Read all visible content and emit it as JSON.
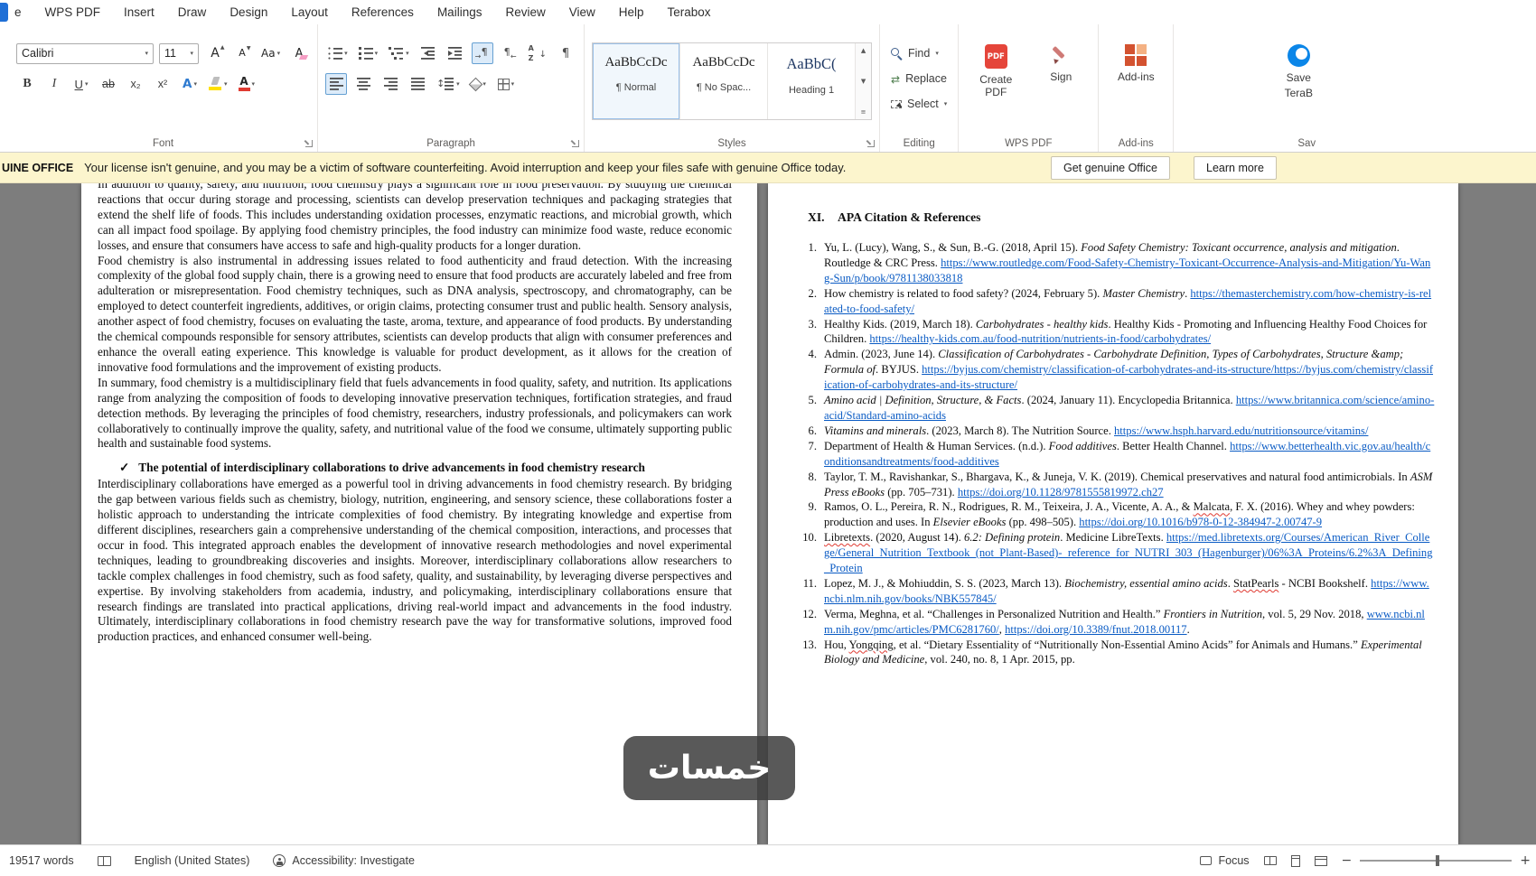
{
  "menu": {
    "tabs": [
      "e",
      "WPS PDF",
      "Insert",
      "Draw",
      "Design",
      "Layout",
      "References",
      "Mailings",
      "Review",
      "View",
      "Help",
      "Terabox"
    ]
  },
  "ribbon": {
    "font_group": {
      "label": "Font",
      "font_name": "Calibri",
      "font_size": "11",
      "bold": "B",
      "italic": "I",
      "underline": "U",
      "strikethrough": "ab",
      "subscript": "x₂",
      "superscript": "x²"
    },
    "paragraph_group": {
      "label": "Paragraph"
    },
    "styles_group": {
      "label": "Styles",
      "items": [
        {
          "preview": "AaBbCcDc",
          "name": "¶ Normal",
          "accent": false,
          "selected": true
        },
        {
          "preview": "AaBbCcDc",
          "name": "¶ No Spac...",
          "accent": false,
          "selected": false
        },
        {
          "preview": "AaBbC(",
          "name": "Heading 1",
          "accent": true,
          "selected": false
        }
      ]
    },
    "editing_group": {
      "label": "Editing",
      "find": "Find",
      "replace": "Replace",
      "select": "Select"
    },
    "wps_pdf_group": {
      "label": "WPS PDF",
      "create_pdf": "Create PDF",
      "sign": "Sign",
      "pdf_badge": "PDF"
    },
    "addins_group": {
      "label": "Add-ins",
      "button": "Add-ins"
    },
    "terabox_group": {
      "label": "Sav",
      "line1": "Save",
      "line2": "TeraB"
    }
  },
  "license_bar": {
    "badge": "UINE OFFICE",
    "message": "Your license isn't genuine, and you may be a victim of software counterfeiting. Avoid interruption and keep your files safe with genuine Office today.",
    "get_genuine": "Get genuine Office",
    "learn_more": "Learn more"
  },
  "document": {
    "left_page": {
      "paragraphs_top": [
        "In addition to quality, safety, and nutrition, food chemistry plays a significant role in food preservation. By studying the chemical reactions that occur during storage and processing, scientists can develop preservation techniques and packaging strategies that extend the shelf life of foods. This includes understanding oxidation processes, enzymatic reactions, and microbial growth, which can all impact food spoilage. By applying food chemistry principles, the food industry can minimize food waste, reduce economic losses, and ensure that consumers have access to safe and high-quality products for a longer duration.",
        "Food chemistry is also instrumental in addressing issues related to food authenticity and fraud detection. With the increasing complexity of the global food supply chain, there is a growing need to ensure that food products are accurately labeled and free from adulteration or misrepresentation. Food chemistry techniques, such as DNA analysis, spectroscopy, and chromatography, can be employed to detect counterfeit ingredients, additives, or origin claims, protecting consumer trust and public health. Sensory analysis, another aspect of food chemistry, focuses on evaluating the taste, aroma, texture, and appearance of food products. By understanding the chemical compounds responsible for sensory attributes, scientists can develop products that align with consumer preferences and enhance the overall eating experience. This knowledge is valuable for product development, as it allows for the creation of innovative food formulations and the improvement of existing products.",
        "In summary, food chemistry is a multidisciplinary field that fuels advancements in food quality, safety, and nutrition. Its applications range from analyzing the composition of foods to developing innovative preservation techniques, fortification strategies, and fraud detection methods. By leveraging the principles of food chemistry, researchers, industry professionals, and policymakers can work collaboratively to continually improve the quality, safety, and nutritional value of the food we consume, ultimately supporting public health and sustainable food systems."
      ],
      "heading": {
        "bullet": "✓",
        "text": "The potential of interdisciplinary collaborations to drive advancements in food chemistry research"
      },
      "paragraphs_bottom": [
        "Interdisciplinary collaborations have emerged as a powerful tool in driving advancements in food chemistry research. By bridging the gap between various fields such as chemistry, biology, nutrition, engineering, and sensory science, these collaborations foster a holistic approach to understanding the intricate complexities of food chemistry. By integrating knowledge and expertise from different disciplines, researchers gain a comprehensive understanding of the chemical composition, interactions, and processes that occur in food. This integrated approach enables the development of innovative research methodologies and novel experimental techniques, leading to groundbreaking discoveries and insights. Moreover, interdisciplinary collaborations allow researchers to tackle complex challenges in food chemistry, such as food safety, quality, and sustainability, by leveraging diverse perspectives and expertise. By involving stakeholders from academia, industry, and policymaking, interdisciplinary collaborations ensure that research findings are translated into practical applications, driving real-world impact and advancements in the food industry. Ultimately, interdisciplinary collaborations in food chemistry research pave the way for transformative solutions, improved food production practices, and enhanced consumer well-being."
      ]
    },
    "right_page": {
      "heading_numeral": "XI.",
      "heading_text": "APA Citation & References",
      "references": [
        {
          "n": "1.",
          "segs": [
            {
              "s": "p",
              "t": "Yu, L. (Lucy), Wang, S., & Sun, B.-G. (2018, April 15). "
            },
            {
              "s": "i",
              "t": "Food Safety Chemistry: Toxicant occurrence, analysis and mitigation"
            },
            {
              "s": "p",
              "t": ". Routledge & CRC Press. "
            },
            {
              "s": "l",
              "t": "https://www.routledge.com/Food-Safety-Chemistry-Toxicant-Occurrence-Analysis-and-Mitigation/Yu-Wang-Sun/p/book/9781138033818"
            }
          ]
        },
        {
          "n": "2.",
          "segs": [
            {
              "s": "p",
              "t": "How chemistry is related to food safety? (2024, February 5). "
            },
            {
              "s": "i",
              "t": "Master Chemistry"
            },
            {
              "s": "p",
              "t": ". "
            },
            {
              "s": "l",
              "t": "https://themasterchemistry.com/how-chemistry-is-related-to-food-safety/"
            }
          ]
        },
        {
          "n": "3.",
          "segs": [
            {
              "s": "p",
              "t": "Healthy Kids. (2019, March 18). "
            },
            {
              "s": "i",
              "t": "Carbohydrates - healthy kids"
            },
            {
              "s": "p",
              "t": ". Healthy Kids - Promoting and Influencing Healthy Food Choices for Children. "
            },
            {
              "s": "l",
              "t": "https://healthy-kids.com.au/food-nutrition/nutrients-in-food/carbohydrates/"
            }
          ]
        },
        {
          "n": "4.",
          "segs": [
            {
              "s": "p",
              "t": "Admin. (2023, June 14). "
            },
            {
              "s": "i",
              "t": "Classification of Carbohydrates - Carbohydrate Definition, Types of Carbohydrates, Structure &amp; Formula of"
            },
            {
              "s": "p",
              "t": ". BYJUS. "
            },
            {
              "s": "l",
              "t": "https://byjus.com/chemistry/classification-of-carbohydrates-and-its-structure/https://byjus.com/chemistry/classification-of-carbohydrates-and-its-structure/"
            }
          ]
        },
        {
          "n": "5.",
          "segs": [
            {
              "s": "i",
              "t": "Amino acid | Definition, Structure, & Facts"
            },
            {
              "s": "p",
              "t": ". (2024, January 11). Encyclopedia Britannica. "
            },
            {
              "s": "l",
              "t": "https://www.britannica.com/science/amino-acid/Standard-amino-acids"
            }
          ]
        },
        {
          "n": "6.",
          "segs": [
            {
              "s": "i",
              "t": "Vitamins and minerals"
            },
            {
              "s": "p",
              "t": ". (2023, March 8). The Nutrition Source. "
            },
            {
              "s": "l",
              "t": "https://www.hsph.harvard.edu/nutritionsource/vitamins/"
            }
          ]
        },
        {
          "n": "7.",
          "segs": [
            {
              "s": "p",
              "t": "Department of Health & Human Services. (n.d.). "
            },
            {
              "s": "i",
              "t": "Food additives"
            },
            {
              "s": "p",
              "t": ". Better Health Channel. "
            },
            {
              "s": "l",
              "t": "https://www.betterhealth.vic.gov.au/health/conditionsandtreatments/food-additives"
            }
          ]
        },
        {
          "n": "8.",
          "segs": [
            {
              "s": "p",
              "t": "Taylor, T. M., Ravishankar, S., Bhargava, K., & Juneja, V. K. (2019). Chemical preservatives and natural food antimicrobials. In "
            },
            {
              "s": "i",
              "t": "ASM Press eBooks"
            },
            {
              "s": "p",
              "t": " (pp. 705–731). "
            },
            {
              "s": "l",
              "t": "https://doi.org/10.1128/9781555819972.ch27"
            }
          ]
        },
        {
          "n": "9.",
          "segs": [
            {
              "s": "p",
              "t": "Ramos, O. L., Pereira, R. N., Rodrigues, R. M., Teixeira, J. A., Vicente, A. A., & "
            },
            {
              "s": "m",
              "t": "Malcata"
            },
            {
              "s": "p",
              "t": ", F. X. (2016). Whey and whey powders: production and uses. In "
            },
            {
              "s": "i",
              "t": "Elsevier eBooks"
            },
            {
              "s": "p",
              "t": " (pp. 498–505). "
            },
            {
              "s": "l",
              "t": "https://doi.org/10.1016/b978-0-12-384947-2.00747-9"
            }
          ]
        },
        {
          "n": "10.",
          "segs": [
            {
              "s": "m",
              "t": "Libretexts"
            },
            {
              "s": "p",
              "t": ". (2020, August 14). "
            },
            {
              "s": "i",
              "t": "6.2: Defining protein"
            },
            {
              "s": "p",
              "t": ". Medicine LibreTexts. "
            },
            {
              "s": "l",
              "t": "https://med.libretexts.org/Courses/American_River_College/General_Nutrition_Textbook_(not_Plant-Based)-_reference_for_NUTRI_303_(Hagenburger)/06%3A_Proteins/6.2%3A_Defining_Protein"
            }
          ]
        },
        {
          "n": "11.",
          "segs": [
            {
              "s": "p",
              "t": "Lopez, M. J., & Mohiuddin, S. S. (2023, March 13). "
            },
            {
              "s": "i",
              "t": "Biochemistry, essential amino acids"
            },
            {
              "s": "p",
              "t": ". "
            },
            {
              "s": "m",
              "t": "StatPearls"
            },
            {
              "s": "p",
              "t": " - NCBI Bookshelf. "
            },
            {
              "s": "l",
              "t": "https://www.ncbi.nlm.nih.gov/books/NBK557845/"
            }
          ]
        },
        {
          "n": "12.",
          "segs": [
            {
              "s": "p",
              "t": "Verma, Meghna, et al. “Challenges in Personalized Nutrition and Health.” "
            },
            {
              "s": "i",
              "t": "Frontiers in Nutrition"
            },
            {
              "s": "p",
              "t": ", vol. 5, 29 Nov. 2018, "
            },
            {
              "s": "l",
              "t": "www.ncbi.nlm.nih.gov/pmc/articles/PMC6281760/"
            },
            {
              "s": "p",
              "t": ", "
            },
            {
              "s": "l",
              "t": "https://doi.org/10.3389/fnut.2018.00117"
            },
            {
              "s": "p",
              "t": "."
            }
          ]
        },
        {
          "n": "13.",
          "segs": [
            {
              "s": "p",
              "t": "Hou, "
            },
            {
              "s": "m",
              "t": "Yongqing"
            },
            {
              "s": "p",
              "t": ", et al. “Dietary Essentiality of “Nutritionally Non-Essential Amino Acids” for Animals and Humans.” "
            },
            {
              "s": "i",
              "t": "Experimental Biology and Medicine"
            },
            {
              "s": "p",
              "t": ", vol. 240, no. 8, 1 Apr. 2015, pp."
            }
          ]
        }
      ]
    }
  },
  "watermark": {
    "text": "خمسات"
  },
  "status_bar": {
    "word_count": "19517 words",
    "language": "English (United States)",
    "accessibility": "Accessibility: Investigate",
    "focus": "Focus"
  }
}
